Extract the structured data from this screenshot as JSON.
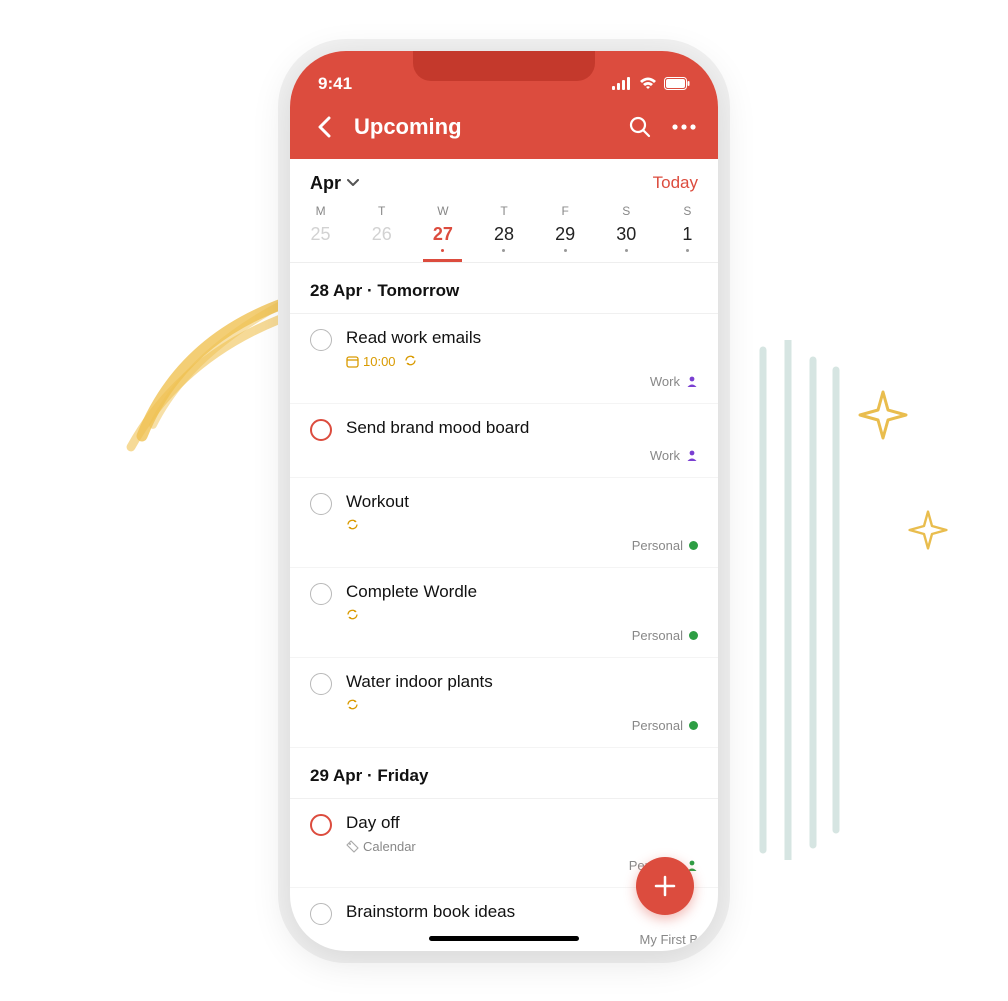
{
  "status": {
    "time": "9:41"
  },
  "header": {
    "title": "Upcoming"
  },
  "calendar": {
    "month": "Apr",
    "today_label": "Today",
    "days": [
      {
        "letter": "M",
        "num": "25",
        "past": true,
        "selected": false,
        "has_dot": false
      },
      {
        "letter": "T",
        "num": "26",
        "past": true,
        "selected": false,
        "has_dot": false
      },
      {
        "letter": "W",
        "num": "27",
        "past": false,
        "selected": true,
        "has_dot": true
      },
      {
        "letter": "T",
        "num": "28",
        "past": false,
        "selected": false,
        "has_dot": true
      },
      {
        "letter": "F",
        "num": "29",
        "past": false,
        "selected": false,
        "has_dot": true
      },
      {
        "letter": "S",
        "num": "30",
        "past": false,
        "selected": false,
        "has_dot": true
      },
      {
        "letter": "S",
        "num": "1",
        "past": false,
        "selected": false,
        "has_dot": true
      }
    ]
  },
  "sections": [
    {
      "header": "28 Apr · Tomorrow",
      "tasks": [
        {
          "title": "Read work emails",
          "priority": false,
          "time": "10:00",
          "recurring": true,
          "label": null,
          "project": "Work",
          "project_style": "person-purple"
        },
        {
          "title": "Send brand mood board",
          "priority": true,
          "time": null,
          "recurring": false,
          "label": null,
          "project": "Work",
          "project_style": "person-purple"
        },
        {
          "title": "Workout",
          "priority": false,
          "time": null,
          "recurring": true,
          "label": null,
          "project": "Personal",
          "project_style": "dot-green"
        },
        {
          "title": "Complete Wordle",
          "priority": false,
          "time": null,
          "recurring": true,
          "label": null,
          "project": "Personal",
          "project_style": "dot-green"
        },
        {
          "title": "Water indoor plants",
          "priority": false,
          "time": null,
          "recurring": true,
          "label": null,
          "project": "Personal",
          "project_style": "dot-green"
        }
      ]
    },
    {
      "header": "29 Apr · Friday",
      "tasks": [
        {
          "title": "Day off",
          "priority": true,
          "time": null,
          "recurring": false,
          "label": "Calendar",
          "project": "Personal",
          "project_style": "person-green"
        },
        {
          "title": "Brainstorm book ideas",
          "priority": false,
          "time": null,
          "recurring": false,
          "label": null,
          "project": "My First B",
          "project_style": "none"
        }
      ]
    }
  ],
  "colors": {
    "accent": "#dc4c3e",
    "gold": "#d99a00",
    "purple": "#7a3fd1",
    "green": "#2e9e44"
  }
}
